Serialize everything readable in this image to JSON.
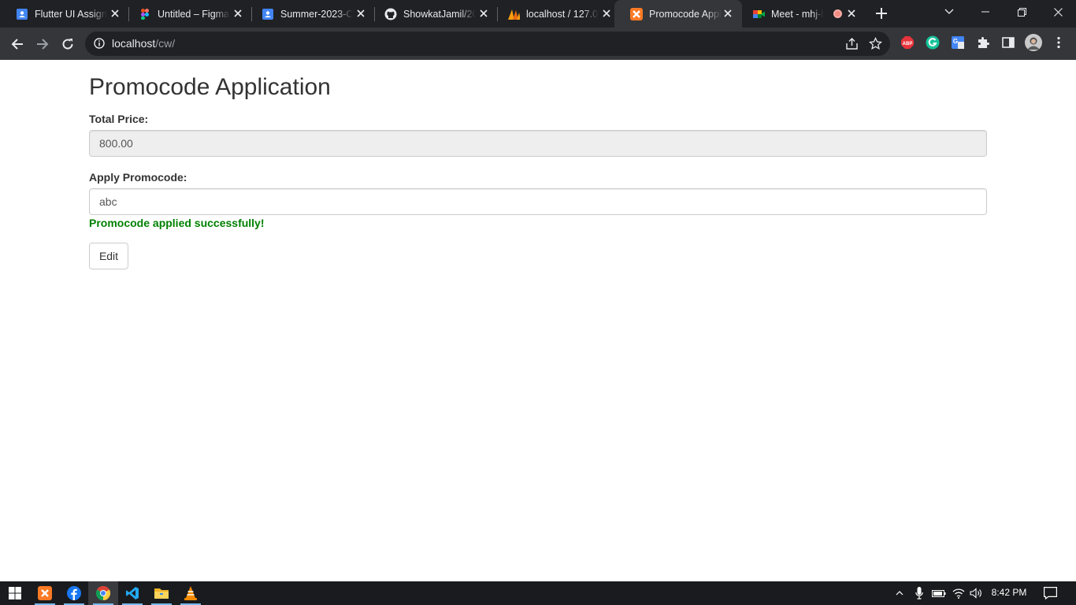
{
  "browser": {
    "tabs": [
      {
        "title": "Flutter UI Assignment",
        "icon": "google-docs-icon",
        "active": false
      },
      {
        "title": "Untitled – Figma",
        "icon": "figma-icon",
        "active": false
      },
      {
        "title": "Summer-2023-CSE",
        "icon": "google-classroom-icon",
        "active": false
      },
      {
        "title": "ShowkatJamil/20",
        "icon": "github-icon",
        "active": false
      },
      {
        "title": "localhost / 127.0.0.1",
        "icon": "phpmyadmin-icon",
        "active": false
      },
      {
        "title": "Promocode Application",
        "icon": "xampp-icon",
        "active": true
      },
      {
        "title": "Meet - mhj-b",
        "icon": "google-meet-icon",
        "active": false,
        "recording": true
      }
    ],
    "address": {
      "host": "localhost",
      "path": "/cw/"
    }
  },
  "page": {
    "title": "Promocode Application",
    "total_price_label": "Total Price:",
    "total_price_value": "800.00",
    "promocode_label": "Apply Promocode:",
    "promocode_value": "abc",
    "success_message": "Promocode applied successfully!",
    "edit_button": "Edit"
  },
  "taskbar": {
    "apps": [
      "start-icon",
      "xampp-icon",
      "facebook-icon",
      "chrome-icon",
      "vscode-icon",
      "file-explorer-icon",
      "vlc-icon"
    ],
    "clock": "8:42 PM"
  },
  "colors": {
    "success": "#008000",
    "tab_strip": "#202124",
    "toolbar": "#35363a",
    "taskbar": "#1a1b1e"
  }
}
